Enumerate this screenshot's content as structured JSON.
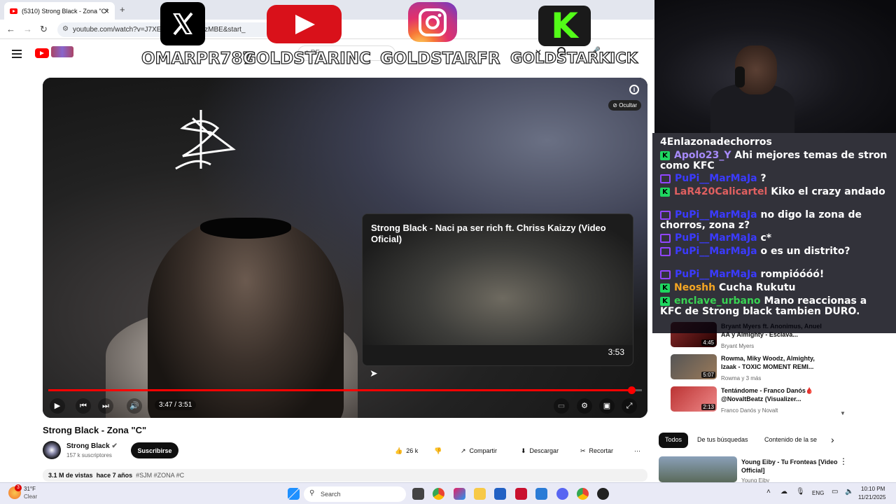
{
  "browser": {
    "tab_title": "(5310) Strong Black - Zona \"C\"",
    "tab_close": "×",
    "new_tab": "+",
    "url": "youtube.com/watch?v=J7XE17…J7XE174zMBE&start_"
  },
  "youtube": {
    "search_text": "c PF"
  },
  "stream_overlay": {
    "handles": [
      "OMARPR787",
      "GOLDSTARINC",
      "GOLDSTARFR",
      "GOLDSTARKICK"
    ],
    "icons": [
      "x-logo-icon",
      "youtube-logo-icon",
      "instagram-logo-icon",
      "kick-logo-icon"
    ],
    "kick_letter": "K"
  },
  "player": {
    "ocultar_label": "Ocultar",
    "info_label": "i",
    "end_card_title": "Strong Black - Naci pa ser rich ft. Chriss Kaizzy (Video Oficial)",
    "end_card_duration": "3:53",
    "time_display": "3:47 / 3:51",
    "progress": 0.982
  },
  "video": {
    "title": "Strong Black - Zona \"C\"",
    "channel": "Strong Black",
    "subscribers": "157 k suscriptores",
    "subscribe_label": "Suscribirse",
    "likes": "26 k",
    "share_label": "Compartir",
    "download_label": "Descargar",
    "clip_label": "Recortar",
    "views": "3.1 M de vistas",
    "age": "hace 7 años",
    "tags": "#SJM #ZONA #C"
  },
  "chat": [
    {
      "user": "",
      "text": "4Enlazonadechorros",
      "badge": "none",
      "color": "#ffffff"
    },
    {
      "user": "Apolo23_Y",
      "text": "Ahi mejores temas de stron como KFC",
      "badge": "kick",
      "color": "#a78bfa"
    },
    {
      "user": "PuPi__MarMaJa",
      "text": "?",
      "badge": "twitch",
      "color": "#3b3bff"
    },
    {
      "user": "LaR420Calicartel",
      "text": "Kiko el crazy andado",
      "badge": "kick",
      "color": "#e06060"
    },
    {
      "user": "PuPi__MarMaJa",
      "text": "no digo la zona de chorros, zona z?",
      "badge": "twitch",
      "color": "#3b3bff"
    },
    {
      "user": "PuPi__MarMaJa",
      "text": "c*",
      "badge": "twitch",
      "color": "#3b3bff"
    },
    {
      "user": "PuPi__MarMaJa",
      "text": "o es un distrito?",
      "badge": "twitch",
      "color": "#3b3bff"
    },
    {
      "user": "PuPi__MarMaJa",
      "text": "rompióóóó!",
      "badge": "twitch",
      "color": "#3b3bff"
    },
    {
      "user": "Neoshh",
      "text": "Cucha Rukutu",
      "badge": "kick",
      "color": "#f5a623"
    },
    {
      "user": "enclave_urbano",
      "text": "Mano reaccionas a KFC de Strong black tambien DURO.",
      "badge": "kick",
      "color": "#39d353"
    }
  ],
  "sidebar": {
    "recs": [
      {
        "title": "Bryant Myers ft. Anonimus, Anuel AA y Almighty - Esclava...",
        "channel": "Bryant Myers",
        "duration": "4:45"
      },
      {
        "title": "Rowma, Miky Woodz, Almighty, Izaak - TOXIC MOMENT REMI...",
        "channel": "Rowma y 3 más",
        "duration": "5:07"
      },
      {
        "title": "Tentándome - Franco Danós🩸 @NovaltBeatz (Visualizer...",
        "channel": "Franco Danós y Novalt",
        "duration": "2:13"
      }
    ],
    "chips": [
      "Todos",
      "De tus búsquedas",
      "Contenido de la se"
    ],
    "bottom_rec": {
      "title": "Young Eiby - Tu Fronteas [Video Official]",
      "channel": "Young Eiby"
    }
  },
  "taskbar": {
    "weather_temp": "31°F",
    "weather_desc": "Clear",
    "weather_badge": "3",
    "search_label": "Search",
    "lang": "ENG",
    "time": "10:10 PM",
    "date": "11/21/2025"
  },
  "colors": {
    "youtube_red": "#ff0000",
    "kick_green": "#1ed760",
    "twitch_purple": "#9146ff"
  }
}
